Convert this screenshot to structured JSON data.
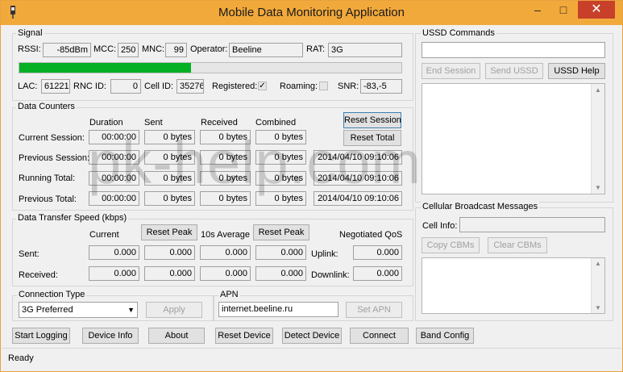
{
  "window": {
    "title": "Mobile Data Monitoring Application",
    "minimize": "–",
    "maximize": "□",
    "close": "✕"
  },
  "signal": {
    "group_label": "Signal",
    "rssi_label": "RSSI:",
    "rssi": "-85dBm",
    "mcc_label": "MCC:",
    "mcc": "250",
    "mnc_label": "MNC:",
    "mnc": "99",
    "operator_label": "Operator:",
    "operator": "Beeline",
    "rat_label": "RAT:",
    "rat": "3G",
    "signal_level_fraction": 0.45,
    "lac_label": "LAC:",
    "lac": "61221",
    "rnc_label": "RNC ID:",
    "rnc": "0",
    "cell_label": "Cell ID:",
    "cell": "35276",
    "registered_label": "Registered:",
    "registered_checked": true,
    "roaming_label": "Roaming:",
    "roaming_checked": false,
    "snr_label": "SNR:",
    "snr": "-83,-5"
  },
  "counters": {
    "group_label": "Data Counters",
    "headers": [
      "Duration",
      "Sent",
      "Received",
      "Combined"
    ],
    "reset_session": "Reset Session",
    "reset_total": "Reset Total",
    "rows": [
      {
        "label": "Current Session:",
        "duration": "00:00:00",
        "sent": "0 bytes",
        "received": "0 bytes",
        "combined": "0 bytes",
        "date": ""
      },
      {
        "label": "Previous Session:",
        "duration": "00:00:00",
        "sent": "0 bytes",
        "received": "0 bytes",
        "combined": "0 bytes",
        "date": "2014/04/10 09:10:06"
      },
      {
        "label": "Running Total:",
        "duration": "00:00:00",
        "sent": "0 bytes",
        "received": "0 bytes",
        "combined": "0 bytes",
        "date": "2014/04/10 09:10:06"
      },
      {
        "label": "Previous Total:",
        "duration": "00:00:00",
        "sent": "0 bytes",
        "received": "0 bytes",
        "combined": "0 bytes",
        "date": "2014/04/10 09:10:06"
      }
    ]
  },
  "speed": {
    "group_label": "Data Transfer Speed (kbps)",
    "current_label": "Current",
    "reset_peak": "Reset Peak",
    "avg_label": "10s Average",
    "reset_peak2": "Reset Peak",
    "qos_label": "Negotiated QoS",
    "sent_label": "Sent:",
    "received_label": "Received:",
    "uplink_label": "Uplink:",
    "downlink_label": "Downlink:",
    "sent": [
      "0.000",
      "0.000",
      "0.000",
      "0.000"
    ],
    "received": [
      "0.000",
      "0.000",
      "0.000",
      "0.000"
    ],
    "uplink": "0.000",
    "downlink": "0.000"
  },
  "connection": {
    "group_label": "Connection Type",
    "selected": "3G Preferred",
    "apply": "Apply"
  },
  "apn": {
    "group_label": "APN",
    "value": "internet.beeline.ru",
    "set_apn": "Set APN"
  },
  "ussd": {
    "group_label": "USSD Commands",
    "input_value": "",
    "end_session": "End Session",
    "send_ussd": "Send USSD",
    "help": "USSD Help"
  },
  "cbm": {
    "group_label": "Cellular Broadcast Messages",
    "cell_info_label": "Cell Info:",
    "cell_info": "",
    "copy": "Copy CBMs",
    "clear": "Clear CBMs"
  },
  "buttons": {
    "start_logging": "Start Logging",
    "device_info": "Device Info",
    "about": "About",
    "reset_device": "Reset Device",
    "detect_device": "Detect Device",
    "connect": "Connect",
    "band_config": "Band Config"
  },
  "status": {
    "text": "Ready"
  },
  "watermark": "pk-help.com",
  "colors": {
    "title_bar": "#f2a93b",
    "close_button": "#c8402a",
    "signal_fill": "#06b025"
  }
}
